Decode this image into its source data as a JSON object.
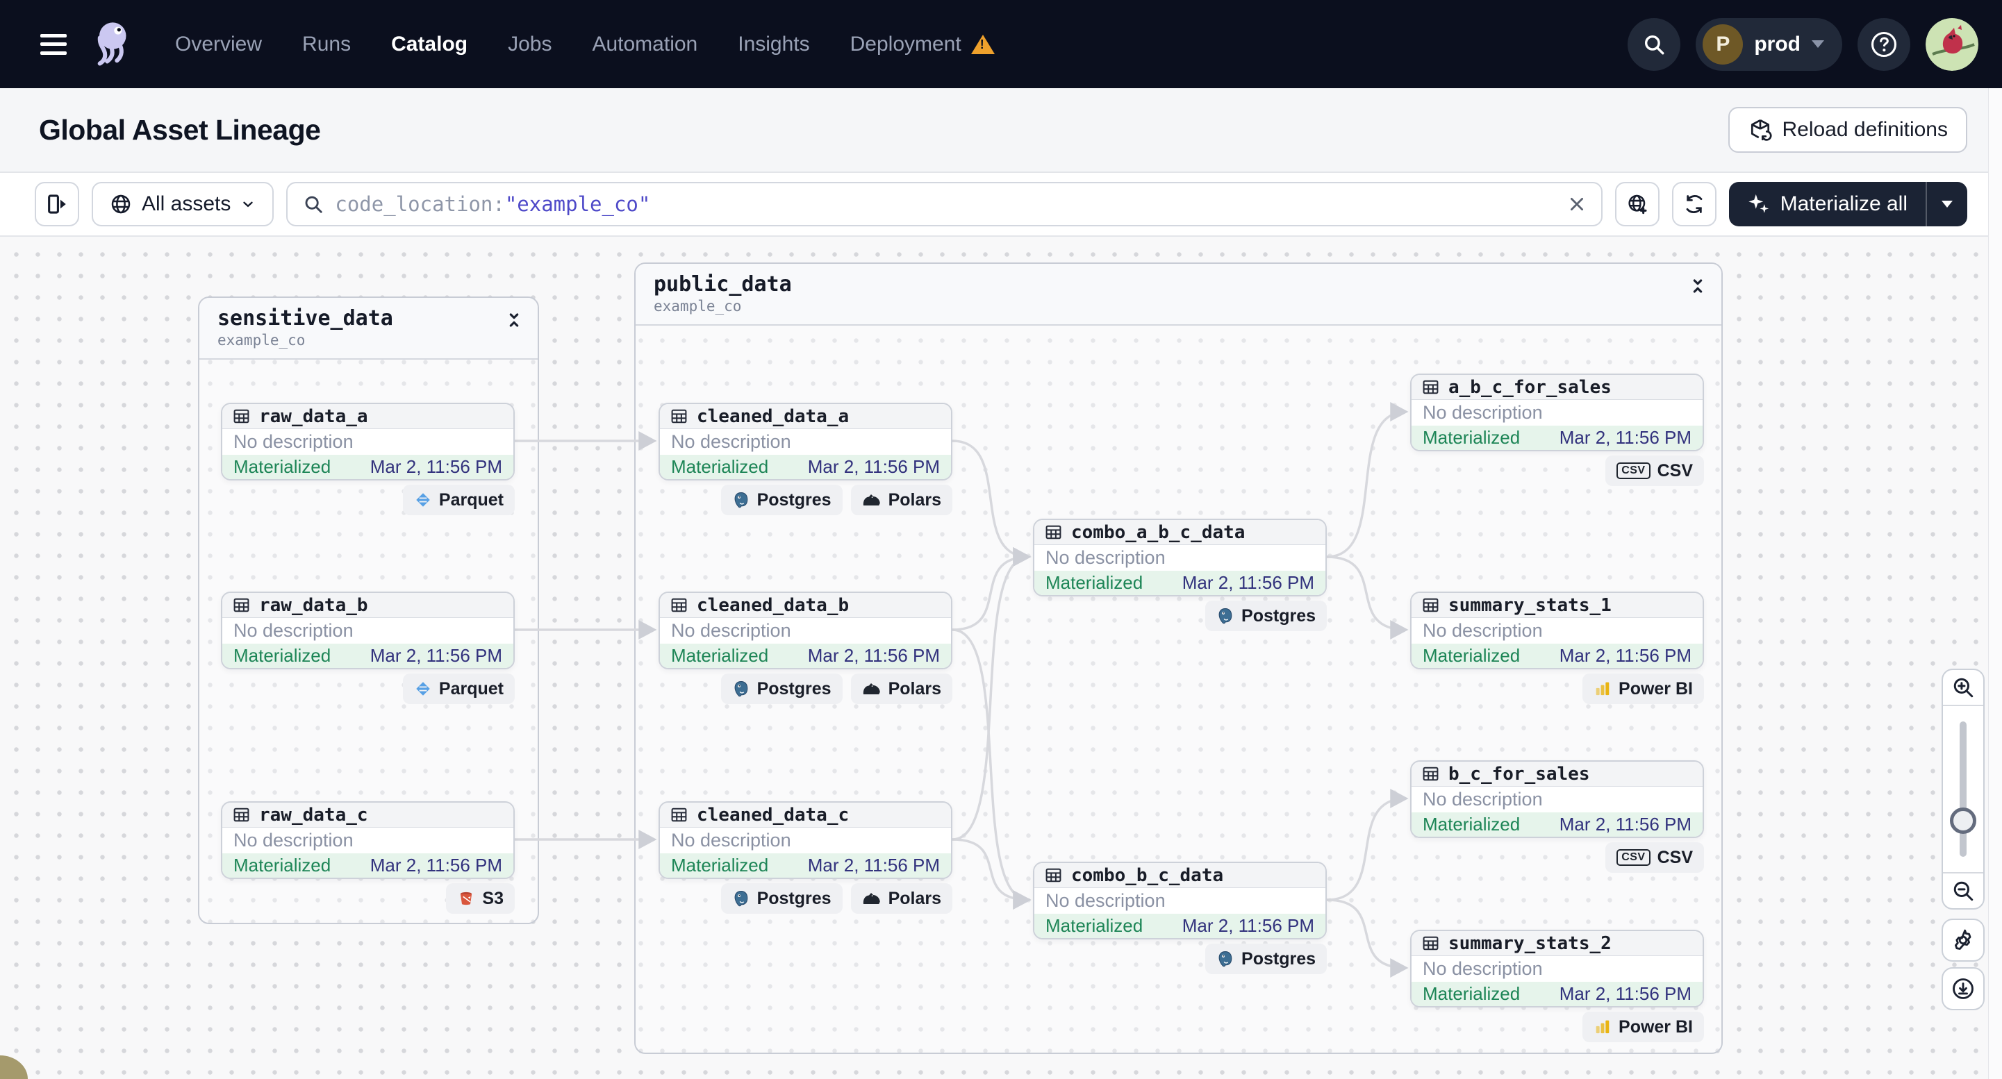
{
  "nav": {
    "items": [
      {
        "label": "Overview"
      },
      {
        "label": "Runs"
      },
      {
        "label": "Catalog"
      },
      {
        "label": "Jobs"
      },
      {
        "label": "Automation"
      },
      {
        "label": "Insights"
      },
      {
        "label": "Deployment",
        "warning": true
      }
    ],
    "active_item": "Catalog",
    "deployment": {
      "letter": "P",
      "name": "prod"
    },
    "icons": [
      "menu-icon",
      "dagster-logo",
      "search-icon",
      "help-icon",
      "user-avatar"
    ]
  },
  "header": {
    "title": "Global Asset Lineage",
    "reload_button_label": "Reload definitions"
  },
  "toolbar": {
    "scope_label": "All assets",
    "search_prefix": "code_location:",
    "search_value": "\"example_co\"",
    "materialize_button_label": "Materialize all",
    "icons": [
      "panel-toggle-icon",
      "globe-icon",
      "search-icon",
      "clear-icon",
      "globe-add-icon",
      "refresh-icon",
      "sparkle-icon",
      "caret-down-icon"
    ]
  },
  "graph": {
    "groups": [
      {
        "name": "sensitive_data",
        "code_location": "example_co"
      },
      {
        "name": "public_data",
        "code_location": "example_co"
      }
    ],
    "node_defaults": {
      "description": "No description",
      "status": "Materialized",
      "timestamp": "Mar 2, 11:56 PM"
    },
    "nodes": [
      {
        "id": "raw_data_a",
        "group": "sensitive_data",
        "kinds": [
          "Parquet"
        ]
      },
      {
        "id": "raw_data_b",
        "group": "sensitive_data",
        "kinds": [
          "Parquet"
        ]
      },
      {
        "id": "raw_data_c",
        "group": "sensitive_data",
        "kinds": [
          "S3"
        ]
      },
      {
        "id": "cleaned_data_a",
        "group": "public_data",
        "kinds": [
          "Postgres",
          "Polars"
        ]
      },
      {
        "id": "cleaned_data_b",
        "group": "public_data",
        "kinds": [
          "Postgres",
          "Polars"
        ]
      },
      {
        "id": "cleaned_data_c",
        "group": "public_data",
        "kinds": [
          "Postgres",
          "Polars"
        ]
      },
      {
        "id": "combo_a_b_c_data",
        "group": "public_data",
        "kinds": [
          "Postgres"
        ]
      },
      {
        "id": "combo_b_c_data",
        "group": "public_data",
        "kinds": [
          "Postgres"
        ]
      },
      {
        "id": "a_b_c_for_sales",
        "group": "public_data",
        "kinds": [
          "CSV"
        ]
      },
      {
        "id": "summary_stats_1",
        "group": "public_data",
        "kinds": [
          "Power BI"
        ]
      },
      {
        "id": "b_c_for_sales",
        "group": "public_data",
        "kinds": [
          "CSV"
        ]
      },
      {
        "id": "summary_stats_2",
        "group": "public_data",
        "kinds": [
          "Power BI"
        ]
      }
    ],
    "edges": [
      [
        "raw_data_a",
        "cleaned_data_a"
      ],
      [
        "raw_data_b",
        "cleaned_data_b"
      ],
      [
        "raw_data_c",
        "cleaned_data_c"
      ],
      [
        "cleaned_data_a",
        "combo_a_b_c_data"
      ],
      [
        "cleaned_data_b",
        "combo_a_b_c_data"
      ],
      [
        "cleaned_data_c",
        "combo_a_b_c_data"
      ],
      [
        "cleaned_data_b",
        "combo_b_c_data"
      ],
      [
        "cleaned_data_c",
        "combo_b_c_data"
      ],
      [
        "combo_a_b_c_data",
        "a_b_c_for_sales"
      ],
      [
        "combo_a_b_c_data",
        "summary_stats_1"
      ],
      [
        "combo_b_c_data",
        "b_c_for_sales"
      ],
      [
        "combo_b_c_data",
        "summary_stats_2"
      ]
    ]
  },
  "controls": {
    "icons": [
      "zoom-in-icon",
      "zoom-out-icon",
      "zoom-slider",
      "settings-gear-icon",
      "download-icon"
    ]
  }
}
